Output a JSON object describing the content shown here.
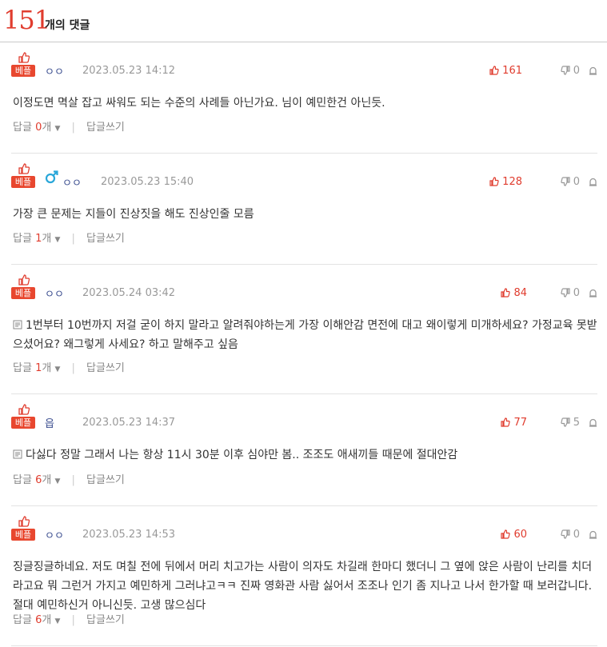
{
  "header": {
    "count": "151",
    "label": "개의 댓글"
  },
  "badge_label": "베플",
  "reply_label": "답글",
  "reply_unit": "개",
  "write_reply_label": "답글쓰기",
  "comments": [
    {
      "author": "ㅇㅇ",
      "gender": "",
      "date": "2023.05.23 14:12",
      "up": "161",
      "down": "0",
      "text": "이정도면 멱살 잡고 싸워도 되는 수준의 사례들 아닌가요. 님이 예민한건 아닌듯.",
      "replies": "0",
      "has_image": false
    },
    {
      "author": "ㅇㅇ",
      "gender": "male",
      "date": "2023.05.23 15:40",
      "up": "128",
      "down": "0",
      "text": "가장 큰 문제는 지들이 진상짓을 해도 진상인줄 모름",
      "replies": "1",
      "has_image": false
    },
    {
      "author": "ㅇㅇ",
      "gender": "",
      "date": "2023.05.24 03:42",
      "up": "84",
      "down": "0",
      "text": "1번부터 10번까지 저걸 굳이 하지 말라고 알려줘야하는게 가장 이해안감 면전에 대고 왜이렇게 미개하세요? 가정교육 못받으셨어요? 왜그렇게 사세요? 하고 말해주고 싶음",
      "replies": "1",
      "has_image": true
    },
    {
      "author": "읍",
      "gender": "",
      "date": "2023.05.23 14:37",
      "up": "77",
      "down": "5",
      "text": "다싫다 정말 그래서 나는 항상 11시 30분 이후 심야만 봄.. 조조도 애새끼들 때문에 절대안감",
      "replies": "6",
      "has_image": true
    },
    {
      "author": "ㅇㅇ",
      "gender": "",
      "date": "2023.05.23 14:53",
      "up": "60",
      "down": "0",
      "text": "징글징글하네요. 저도 며칠 전에 뒤에서 머리 치고가는 사람이 의자도 차길래 한마디 했더니 그 옆에 앉은 사람이 난리를 치더라고요 뭐 그런거 가지고 예민하게 그러냐고ㅋㅋ 진짜 영화관 사람 싫어서 조조나 인기 좀 지나고 나서 한가할 때 보러갑니다. 절대 예민하신거 아니신듯. 고생 많으심다",
      "replies": "6",
      "has_image": false
    }
  ]
}
